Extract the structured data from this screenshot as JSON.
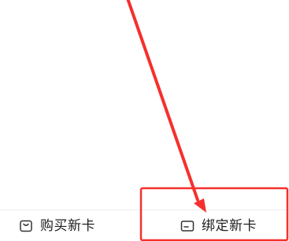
{
  "bottom_bar": {
    "buy_label": "购买新卡",
    "buy_icon": "shopping-bag-icon",
    "bind_label": "绑定新卡",
    "bind_icon": "card-icon"
  },
  "annotation": {
    "color": "#f5302c",
    "arrow_icon": "red-arrow-icon",
    "highlight": "red-highlight-box"
  }
}
